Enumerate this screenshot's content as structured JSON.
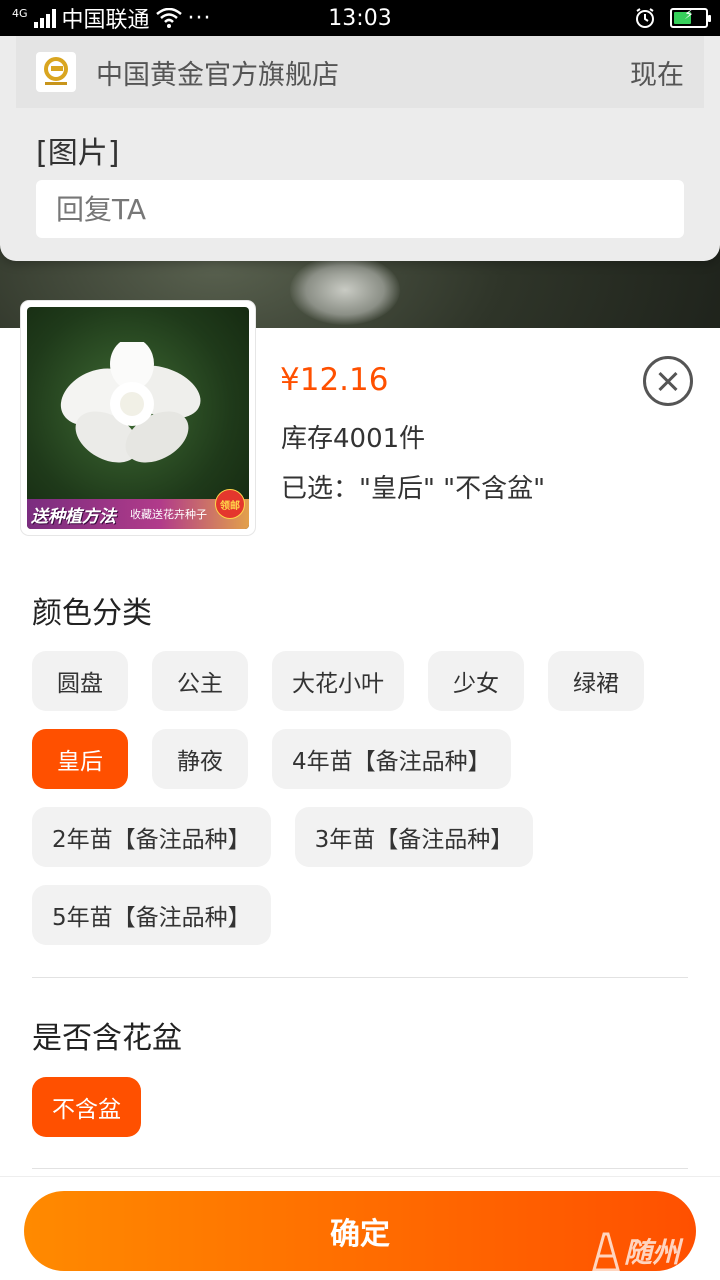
{
  "status_bar": {
    "network": "4G",
    "carrier": "中国联通",
    "dots": "···",
    "time": "13:03"
  },
  "notification": {
    "app_name": "中国黄金官方旗舰店",
    "time": "现在",
    "body": "[图片]",
    "reply_placeholder": "回复TA"
  },
  "product": {
    "price": "¥12.16",
    "stock": "库存4001件",
    "selected": "已选：\"皇后\" \"不含盆\"",
    "image_text": {
      "corner": "",
      "banner_main": "送种植方法",
      "banner_sub": "收藏送花卉种子",
      "badge": "领邮"
    }
  },
  "color_section": {
    "title": "颜色分类",
    "options": [
      {
        "label": "圆盘",
        "selected": false
      },
      {
        "label": "公主",
        "selected": false
      },
      {
        "label": "大花小叶",
        "selected": false
      },
      {
        "label": "少女",
        "selected": false
      },
      {
        "label": "绿裙",
        "selected": false
      },
      {
        "label": "皇后",
        "selected": true
      },
      {
        "label": "静夜",
        "selected": false
      },
      {
        "label": "4年苗【备注品种】",
        "selected": false
      },
      {
        "label": "2年苗【备注品种】",
        "selected": false
      },
      {
        "label": "3年苗【备注品种】",
        "selected": false
      },
      {
        "label": "5年苗【备注品种】",
        "selected": false
      }
    ]
  },
  "pot_section": {
    "title": "是否含花盆",
    "options": [
      {
        "label": "不含盆",
        "selected": true
      }
    ]
  },
  "confirm_label": "确定",
  "watermark": "随州",
  "colors": {
    "accent": "#ff5000",
    "chip_bg": "#f2f2f2"
  }
}
